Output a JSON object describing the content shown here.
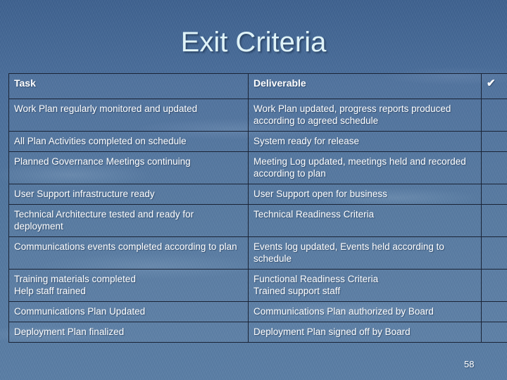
{
  "slide": {
    "title": "Exit Criteria",
    "page_number": "58",
    "background_color": "#4e729f",
    "title_color": "#dff3f8"
  },
  "table": {
    "headers": {
      "task": "Task",
      "deliverable": "Deliverable",
      "check": "✔"
    },
    "rows": [
      {
        "task": "Work Plan regularly monitored and updated",
        "deliverable": "Work Plan updated, progress reports produced according to agreed schedule",
        "check": ""
      },
      {
        "task": "All Plan Activities completed on schedule",
        "deliverable": "System ready for release",
        "check": ""
      },
      {
        "task": "Planned Governance Meetings continuing",
        "deliverable": "Meeting Log updated, meetings held and recorded according to plan",
        "check": ""
      },
      {
        "task": "User Support infrastructure ready",
        "deliverable": "User Support open for business",
        "check": ""
      },
      {
        "task": "Technical Architecture tested and ready for deployment",
        "deliverable": "Technical Readiness Criteria",
        "check": ""
      },
      {
        "task": "Communications events completed according to plan",
        "deliverable": "Events log updated, Events held according to schedule",
        "check": ""
      },
      {
        "task": "Training materials completed\nHelp staff trained",
        "deliverable": "Functional Readiness Criteria\nTrained support staff",
        "check": ""
      },
      {
        "task": "Communications Plan Updated",
        "deliverable": "Communications Plan authorized by Board",
        "check": ""
      },
      {
        "task": "Deployment Plan finalized",
        "deliverable": "Deployment Plan signed off by Board",
        "check": ""
      }
    ]
  }
}
